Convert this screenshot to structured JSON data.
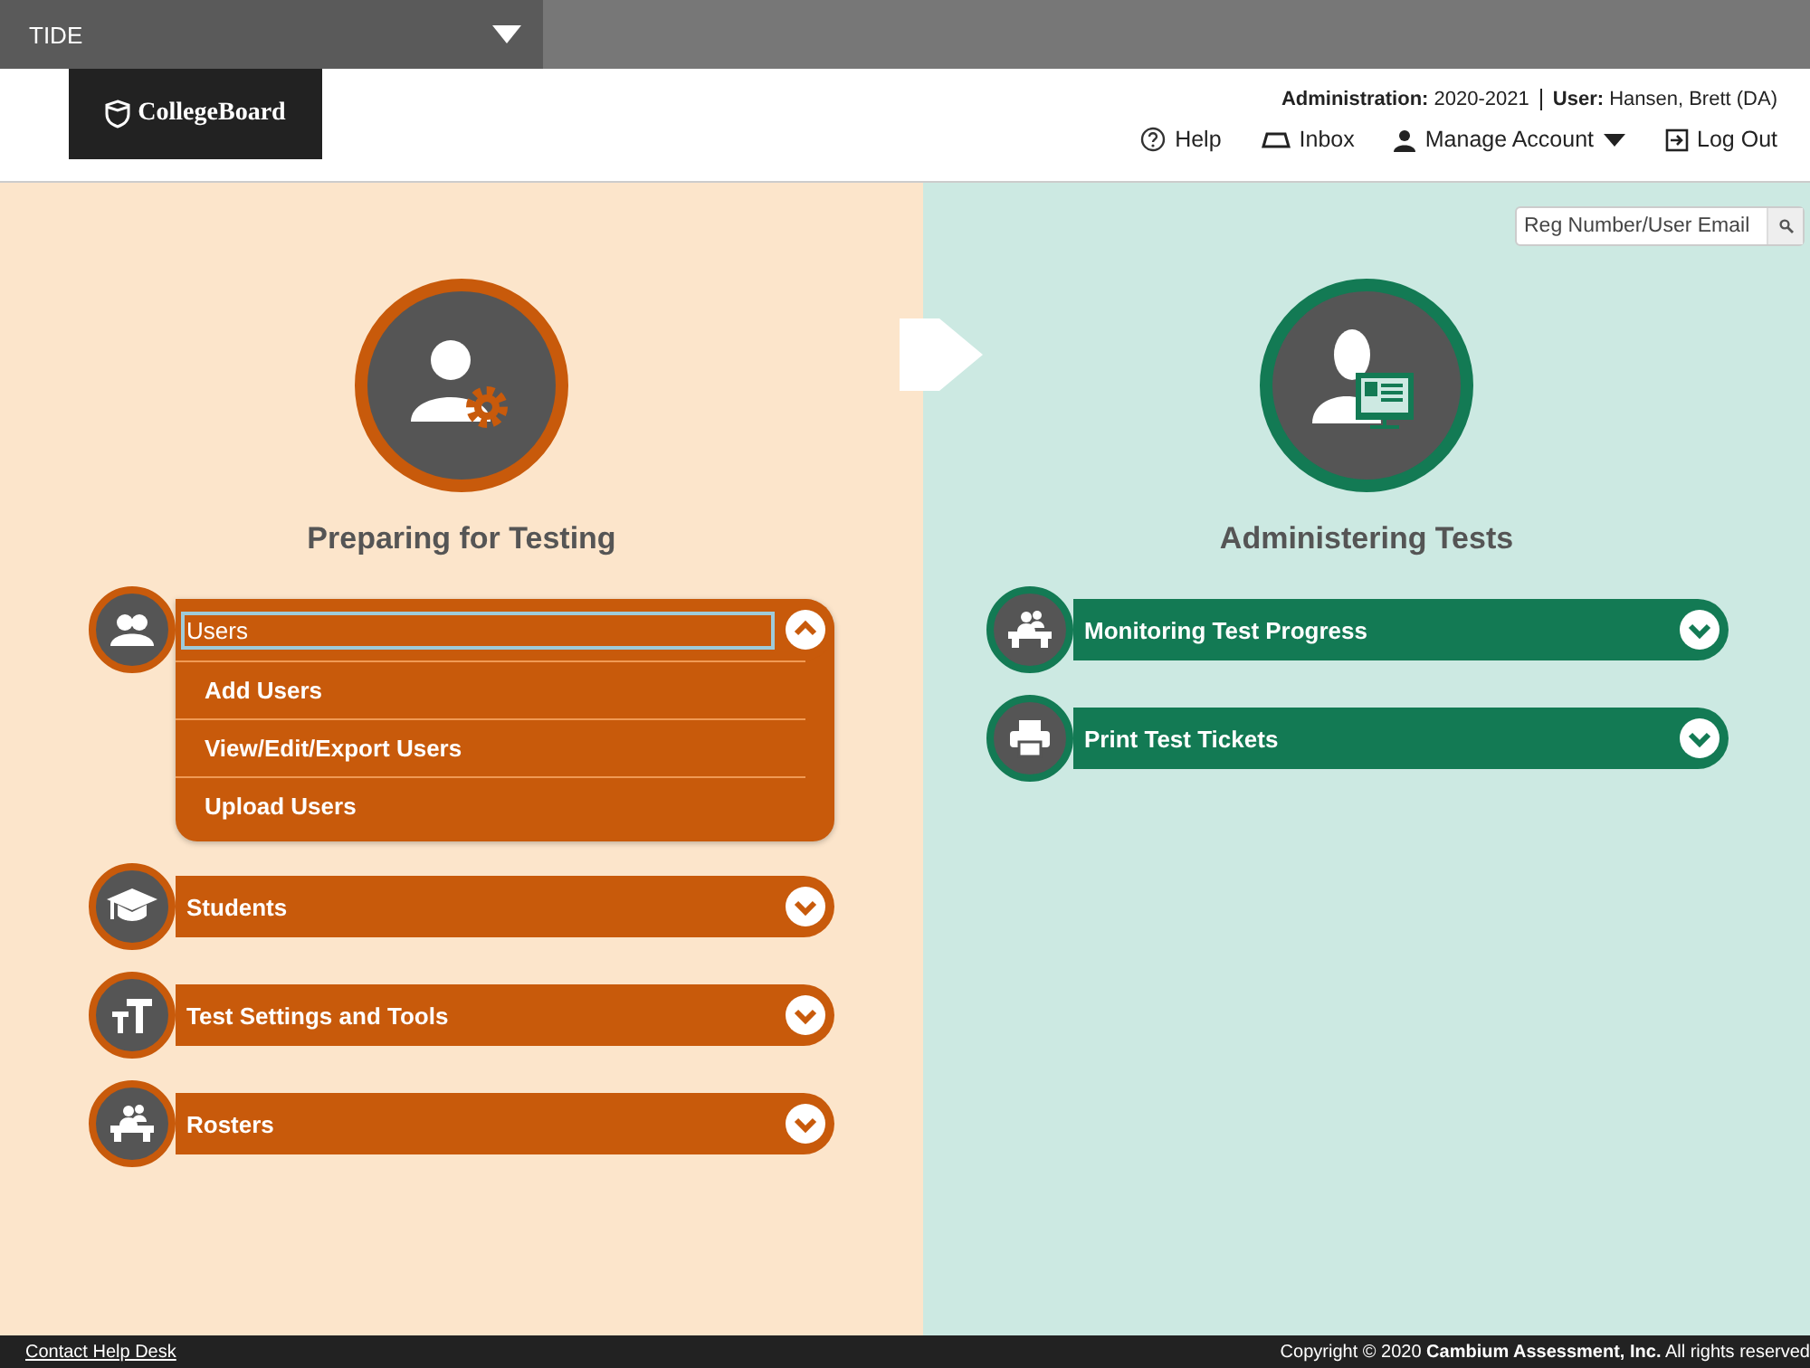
{
  "topbar": {
    "app_name": "TIDE"
  },
  "header": {
    "logo": "CollegeBoard",
    "admin_label": "Administration:",
    "admin_value": "2020-2021",
    "user_label": "User:",
    "user_value": "Hansen, Brett (DA)",
    "links": [
      {
        "label": "Help",
        "kind": "help"
      },
      {
        "label": "Inbox",
        "kind": "inbox"
      },
      {
        "label": "Manage Account",
        "kind": "account",
        "dropdown": true
      },
      {
        "label": "Log Out",
        "kind": "logout"
      }
    ]
  },
  "panels": [
    {
      "title": "Preparing for Testing",
      "kind": "preparing",
      "color": "#c85a0b",
      "items": [
        {
          "label": "Users",
          "kind": "users",
          "expanded": true,
          "focused": true,
          "children": [
            {
              "label": "Add Users"
            },
            {
              "label": "View/Edit/Export Users"
            },
            {
              "label": "Upload Users"
            }
          ]
        },
        {
          "label": "Students",
          "kind": "students",
          "expanded": false,
          "focused": false
        },
        {
          "label": "Test Settings and Tools",
          "kind": "settings",
          "expanded": false,
          "focused": false
        },
        {
          "label": "Rosters",
          "kind": "rosters",
          "expanded": false,
          "focused": false
        }
      ]
    },
    {
      "title": "Administering Tests",
      "kind": "administering",
      "color": "#137a54",
      "search": {
        "placeholder": "Reg Number/User Email"
      },
      "items": [
        {
          "label": "Monitoring Test Progress",
          "kind": "rosters",
          "expanded": false,
          "focused": false
        },
        {
          "label": "Print Test Tickets",
          "kind": "tickets",
          "expanded": false,
          "focused": false
        }
      ]
    }
  ],
  "footer": {
    "link": "Contact Help Desk",
    "copyright_prefix": "Copyright © 2020",
    "copyright_company": "Cambium Assessment, Inc.",
    "copyright_suffix": "All rights reserved"
  }
}
